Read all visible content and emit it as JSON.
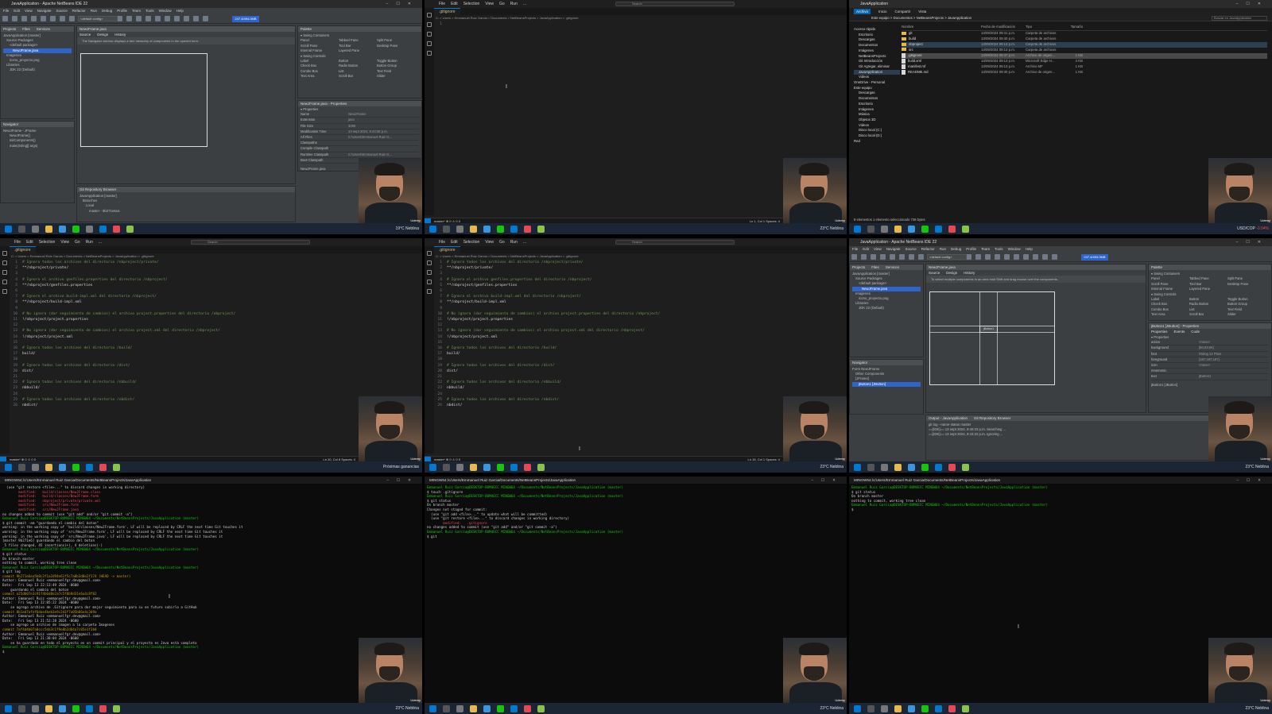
{
  "taskbar": {
    "weather_a": "19°C Neblina",
    "weather_b": "23°C Neblina",
    "weather_c": "Próximas ganancias",
    "currency": "USD/COP",
    "currency_change": "-0.04%"
  },
  "webcam_label": "Udemy",
  "netbeans": {
    "title": "JavaApplication - Apache NetBeans IDE 22",
    "menu": [
      "File",
      "Edit",
      "View",
      "Navigate",
      "Source",
      "Refactor",
      "Run",
      "Debug",
      "Profile",
      "Team",
      "Tools",
      "Window",
      "Help"
    ],
    "config": "<default config>",
    "memory": "247.4/494.0MB",
    "projects_tabs": [
      "Projects",
      "Files",
      "Services"
    ],
    "tree": [
      "JavaApplication [master]",
      "Source Packages",
      "<default package>",
      "NewJFrame.java",
      "Imagenes",
      "icono_proyecto.png",
      "Libraries",
      "JDK 22 (Default)"
    ],
    "design_tabs": [
      "Source",
      "Design",
      "History"
    ],
    "hint": "The Navigator window displays a tree hierarchy of components in the opened form.",
    "hint2": "To select multiple components in an area hold Shift and drag mouse over the components.",
    "navigator_title": "Navigator",
    "navigator": [
      "NewJFrame - JFrame",
      "NewJFrame()",
      "initComponents()",
      "main(String[] args)"
    ],
    "navigator_b": [
      "Form NewJFrame",
      "Other Components",
      "[JFrame]",
      "jButton1 [JButton]"
    ],
    "palette_title": "Palette",
    "palette_sections": [
      "Swing Containers",
      "Swing Controls"
    ],
    "palette_containers": [
      "Panel",
      "Tabbed Pane",
      "Split Pane",
      "Scroll Pane",
      "Tool Bar",
      "Desktop Pane",
      "Internal Frame",
      "Layered Pane"
    ],
    "palette_controls": [
      "Label",
      "Button",
      "Toggle Button",
      "Check Box",
      "Radio Button",
      "Button Group",
      "Combo Box",
      "List",
      "Text Field",
      "Text Area",
      "Scroll Bar",
      "Slider"
    ],
    "props_title": "NewJFrame.java - Properties",
    "props_head": "Properties",
    "props": [
      [
        "Name",
        "NewJFrame"
      ],
      [
        "Extension",
        "java"
      ],
      [
        "File Size",
        "3096"
      ],
      [
        "Modification Time",
        "13 sept 2024, 9:43:35 p.m."
      ],
      [
        "All Files",
        "C:\\Users\\Emmanuel Ruiz G..."
      ],
      [
        "Classpaths",
        ""
      ],
      [
        "Compile Classpath",
        ""
      ],
      [
        "Runtime Classpath",
        "C:\\Users\\Emmanuel Ruiz G..."
      ],
      [
        "Boot Classpath",
        ""
      ]
    ],
    "props_file": "NewJFrame.java",
    "git_title": "Git Repository Browser",
    "git_tree": [
      "JavaApplication [master]",
      "Branches",
      "Local",
      "master - 9b271e6ea"
    ],
    "props_b_title": "jButton1 [JButton] - Properties",
    "props_b_tabs": [
      "Properties",
      "Events",
      "Code"
    ],
    "props_b": [
      [
        "action",
        "<none>"
      ],
      [
        "background",
        "[60,63,65]"
      ],
      [
        "font",
        "Dialog 12 Plain"
      ],
      [
        "foreground",
        "[187,187,187]"
      ],
      [
        "icon",
        "<none>"
      ],
      [
        "mnemonic",
        ""
      ],
      [
        "text",
        "jButton1"
      ]
    ],
    "props_b_foot": "jButton1 [JButton]",
    "button_label": "jButton1",
    "output_tabs": [
      "Output - JavaApplication",
      "Git Repository Browser"
    ],
    "output": [
      "git log --name-status master",
      "==[IDE]== 13 sept 2024, 9:40:23 p.m. Searching ...",
      "==[IDE]== 13 sept 2024, 9:43:22 p.m. Ignoring ..."
    ]
  },
  "vscode": {
    "menu": [
      "File",
      "Edit",
      "Selection",
      "View",
      "Go",
      "Run",
      "..."
    ],
    "search": "Search",
    "tab": ".gitignore",
    "breadcrumb": "C: > Users > Emmanuel Ruiz Garcia > Documents > NetBeansProjects > JavaApplication > .gitignore",
    "status_left": "master*  ⊗ 0 ⚠ 0   0",
    "status_right_a": "Ln 1, Col 1   Spaces: 4",
    "status_right_b": "Ln 20, Col 8   Spaces: 4",
    "status_right_c": "Ln 15, Col 1   Spaces: 4",
    "code": [
      [
        "1",
        "# Ignora todos los archivos del directorio /nbproject/private/",
        "com"
      ],
      [
        "2",
        "**/nbproject/private/",
        "txt"
      ],
      [
        "3",
        "",
        "txt"
      ],
      [
        "4",
        "# Ignora el archivo genfiles.properties del directorio /nbproject/",
        "com"
      ],
      [
        "5",
        "**/nbproject/genfiles.properties",
        "txt"
      ],
      [
        "6",
        "",
        "txt"
      ],
      [
        "7",
        "# Ignora el archivo build-impl.xml del directorio /nbproject/",
        "com"
      ],
      [
        "8",
        "**/nbproject/build-impl.xml",
        "txt"
      ],
      [
        "9",
        "",
        "txt"
      ],
      [
        "10",
        "# No ignora (dar seguimiento de cambios) el archivo project.properties del directorio /nbproject/",
        "com"
      ],
      [
        "11",
        "!/nbproject/project.properties",
        "txt"
      ],
      [
        "12",
        "",
        "txt"
      ],
      [
        "13",
        "# No ignora (dar seguimiento de cambios) el archivo project.xml del directorio /nbproject/",
        "com"
      ],
      [
        "14",
        "!/nbproject/project.xml",
        "txt"
      ],
      [
        "15",
        "",
        "txt"
      ],
      [
        "16",
        "# Ignora todos los archivos del directorio /build/",
        "com"
      ],
      [
        "17",
        "build/",
        "txt"
      ],
      [
        "18",
        "",
        "txt"
      ],
      [
        "19",
        "# Ignora todos los archivos del directorio /dist/",
        "com"
      ],
      [
        "20",
        "dist/",
        "txt"
      ],
      [
        "21",
        "",
        "txt"
      ],
      [
        "22",
        "# Ignora todos los archivos del directorio /nbbuild/",
        "com"
      ],
      [
        "23",
        "nbbuild/",
        "txt"
      ],
      [
        "24",
        "",
        "txt"
      ],
      [
        "25",
        "# Ignora todos los archivos del directorio /nbdist/",
        "com"
      ],
      [
        "26",
        "nbdist/",
        "txt"
      ]
    ]
  },
  "explorer": {
    "title": "JavaApplication",
    "ribbon": [
      "Archivo",
      "Inicio",
      "Compartir",
      "Vista"
    ],
    "address": "Este equipo > Documentos > NetBeansProjects > JavaApplication",
    "search": "Buscar en JavaApplication",
    "nav": [
      "Acceso rápido",
      "Escritorio",
      "Descargas",
      "Documentos",
      "Imágenes",
      "NetBeansProjects",
      "Git Introducción",
      "Git Agregar, eliminar",
      "JavaApplication",
      "Videos",
      "OneDrive - Personal",
      "Este equipo",
      "Descargas",
      "Documentos",
      "Escritorio",
      "Imágenes",
      "Música",
      "Objetos 3D",
      "Videos",
      "Disco local (C:)",
      "Disco local (D:)",
      "Red"
    ],
    "columns": [
      "Nombre",
      "Fecha de modificación",
      "Tipo",
      "Tamaño"
    ],
    "files": [
      [
        "git",
        "13/09/2024 09:41 p.m.",
        "Carpeta de archivos",
        "",
        "folder"
      ],
      [
        "build",
        "13/09/2024 09:40 p.m.",
        "Carpeta de archivos",
        "",
        "folder"
      ],
      [
        "nbproject",
        "13/09/2024 09:13 p.m.",
        "Carpeta de archivos",
        "",
        "folder"
      ],
      [
        "src",
        "13/09/2024 09:13 p.m.",
        "Carpeta de archivos",
        "",
        "folder"
      ],
      [
        ".gitignore",
        "13/09/2024 09:47 p.m.",
        "Archivo de origen...",
        "1 KB",
        "file"
      ],
      [
        "build.xml",
        "13/09/2024 09:13 p.m.",
        "Microsoft Edge H...",
        "4 KB",
        "file"
      ],
      [
        "manifest.mf",
        "13/09/2024 09:13 p.m.",
        "Archivo MF",
        "1 KB",
        "file"
      ],
      [
        "README.md",
        "13/09/2024 09:40 p.m.",
        "Archivo de origen...",
        "1 KB",
        "file"
      ]
    ],
    "footer": "8 elementos   1 elemento seleccionado  736 bytes"
  },
  "terminals": {
    "title": "MINGW64:/c/Users/Emmanuel Ruiz Garcia/Documents/NetBeansProjects/JavaApplication",
    "t1": [
      [
        "  (use \"git restore <file>...\" to discard changes in working directory)",
        "w"
      ],
      [
        "        modified:   build/classes/NewJFrame.class",
        "r"
      ],
      [
        "        modified:   build/classes/NewJFrame.form",
        "r"
      ],
      [
        "        modified:   nbproject/private/private.xml",
        "r"
      ],
      [
        "        modified:   src/NewJFrame.form",
        "r"
      ],
      [
        "        modified:   src/NewJFrame.java",
        "r"
      ],
      [
        "",
        "w"
      ],
      [
        "no changes added to commit (use \"git add\" and/or \"git commit -a\")",
        "w"
      ],
      [
        "",
        "w"
      ],
      [
        "Emmanuel Ruiz Garcia@DESKTOP-BUM4ECC MINGW64 ~/Documents/NetBeansProjects/JavaApplication (master)",
        "g"
      ],
      [
        "$ git commit -am \"guardando el cambio del boton\"",
        "w"
      ],
      [
        "warning: in the working copy of 'build/classes/NewJFrame.form', LF will be replaced by CRLF the next time Git touches it",
        "w"
      ],
      [
        "warning: in the working copy of 'src/NewJFrame.form', LF will be replaced by CRLF the next time Git touches it",
        "w"
      ],
      [
        "warning: in the working copy of 'src/NewJFrame.java', LF will be replaced by CRLF the next time Git touches it",
        "w"
      ],
      [
        "[master 9b271e6] guardando el cambio del boton",
        "w"
      ],
      [
        " 5 files changed, 45 insertions(+), 4 deletions(-)",
        "w"
      ],
      [
        "",
        "w"
      ],
      [
        "Emmanuel Ruiz Garcia@DESKTOP-BUM4ECC MINGW64 ~/Documents/NetBeansProjects/JavaApplication (master)",
        "g"
      ],
      [
        "$ git status",
        "w"
      ],
      [
        "On branch master",
        "w"
      ],
      [
        "nothing to commit, working tree clean",
        "w"
      ],
      [
        "",
        "w"
      ],
      [
        "Emmanuel Ruiz Garcia@DESKTOP-BUM4ECC MINGW64 ~/Documents/NetBeansProjects/JavaApplication (master)",
        "g"
      ],
      [
        "$ git log",
        "w"
      ],
      [
        "commit 9b271e6ea5b8c3f1a2d94e61f5c7a0b3d8e2f174 (HEAD -> master)",
        "y"
      ],
      [
        "Author: Emmanuel Ruiz <emmanuelfgr.dev@gmail.com>",
        "w"
      ],
      [
        "Date:   Fri Sep 13 22:13:49 2024 -0600",
        "w"
      ],
      [
        "",
        "w"
      ],
      [
        "    guardando el cambio del boton",
        "w"
      ],
      [
        "",
        "w"
      ],
      [
        "commit a25db07e3c91f4b6d8e2a7c5f0b9d31e6a4c8f02",
        "y"
      ],
      [
        "Author: Emmanuel Ruiz <emmanuelfgr.dev@gmail.com>",
        "w"
      ],
      [
        "Date:   Fri Sep 13 22:05:22 2024 -0600",
        "w"
      ],
      [
        "",
        "w"
      ],
      [
        "    se agrego archivo de .Gitignore para dar mejor seguimiento para su en futuro subirlo a GitHub",
        "w"
      ],
      [
        "",
        "w"
      ],
      [
        "commit 8b1ad7afef6dae4beb3e9c2d1f7a05b86e4c3d9a",
        "y"
      ],
      [
        "Author: Emmanuel Ruiz <emmanuelfgr.dev@gmail.com>",
        "w"
      ],
      [
        "Date:   Fri Sep 13 21:52:28 2024 -0600",
        "w"
      ],
      [
        "",
        "w"
      ],
      [
        "    se agrego un archivo de imagen a la carpeta Imagenes",
        "w"
      ],
      [
        "",
        "w"
      ],
      [
        "commit 7af4d4b07a0ccc5da3c1f9e8b2d64a7c05e1f3b8",
        "y"
      ],
      [
        "Author: Emmanuel Ruiz <emmanuelfgr.dev@gmail.com>",
        "w"
      ],
      [
        "Date:   Fri Sep 13 21:38:04 2024 -0600",
        "w"
      ],
      [
        "",
        "w"
      ],
      [
        "    se ha guardado en todo el proyecto en un commit principal y el proyecto es Java está completo",
        "w"
      ],
      [
        "",
        "w"
      ],
      [
        "Emmanuel Ruiz Garcia@DESKTOP-BUM4ECC MINGW64 ~/Documents/NetBeansProjects/JavaApplication (master)",
        "g"
      ],
      [
        "$",
        "w"
      ]
    ],
    "t2": [
      [
        "Emmanuel Ruiz Garcia@DESKTOP-BUM4ECC MINGW64 ~/Documents/NetBeansProjects/JavaApplication (master)",
        "g"
      ],
      [
        "$ touch .gitignore",
        "w"
      ],
      [
        "",
        "w"
      ],
      [
        "Emmanuel Ruiz Garcia@DESKTOP-BUM4ECC MINGW64 ~/Documents/NetBeansProjects/JavaApplication (master)",
        "g"
      ],
      [
        "$ git status",
        "w"
      ],
      [
        "On branch master",
        "w"
      ],
      [
        "Changes not staged for commit:",
        "w"
      ],
      [
        "  (use \"git add <file>...\" to update what will be committed)",
        "w"
      ],
      [
        "  (use \"git restore <file>...\" to discard changes in working directory)",
        "w"
      ],
      [
        "        modified:   .gitignore",
        "r"
      ],
      [
        "",
        "w"
      ],
      [
        "no changes added to commit (use \"git add\" and/or \"git commit -a\")",
        "w"
      ],
      [
        "",
        "w"
      ],
      [
        "Emmanuel Ruiz Garcia@DESKTOP-BUM4ECC MINGW64 ~/Documents/NetBeansProjects/JavaApplication (master)",
        "g"
      ],
      [
        "$ git",
        "w"
      ]
    ],
    "t3": [
      [
        "Emmanuel Ruiz Garcia@DESKTOP-BUM4ECC MINGW64 ~/Documents/NetBeansProjects/JavaApplication (master)",
        "g"
      ],
      [
        "$ git status",
        "w"
      ],
      [
        "On branch master",
        "w"
      ],
      [
        "nothing to commit, working tree clean",
        "w"
      ],
      [
        "",
        "w"
      ],
      [
        "Emmanuel Ruiz Garcia@DESKTOP-BUM4ECC MINGW64 ~/Documents/NetBeansProjects/JavaApplication (master)",
        "g"
      ],
      [
        "$",
        "w"
      ]
    ]
  }
}
